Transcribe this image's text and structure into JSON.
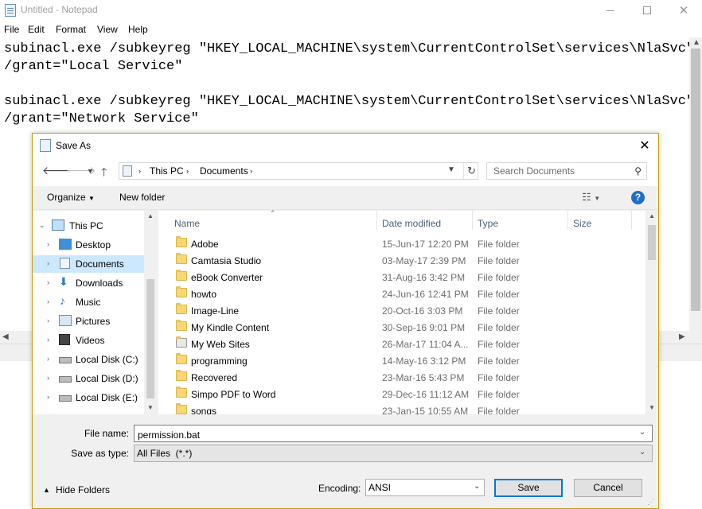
{
  "notepad": {
    "title": "Untitled - Notepad",
    "menu": [
      "File",
      "Edit",
      "Format",
      "View",
      "Help"
    ],
    "lines": [
      "subinacl.exe /subkeyreg \"HKEY_LOCAL_MACHINE\\system\\CurrentControlSet\\services\\NlaSvc\"",
      "/grant=\"Local Service\"",
      "",
      "subinacl.exe /subkeyreg \"HKEY_LOCAL_MACHINE\\system\\CurrentControlSet\\services\\NlaSvc\"",
      "/grant=\"Network Service\""
    ]
  },
  "dialog": {
    "title": "Save As",
    "breadcrumb": [
      "This PC",
      "Documents"
    ],
    "search_placeholder": "Search Documents",
    "toolbar": {
      "organize": "Organize",
      "new_folder": "New folder"
    },
    "tree": [
      {
        "label": "This PC",
        "icon": "computer-icon",
        "level": 0,
        "expanded": true
      },
      {
        "label": "Desktop",
        "icon": "desktop-icon",
        "level": 1
      },
      {
        "label": "Documents",
        "icon": "documents-icon",
        "level": 1,
        "selected": true
      },
      {
        "label": "Downloads",
        "icon": "downloads-icon",
        "level": 1
      },
      {
        "label": "Music",
        "icon": "music-icon",
        "level": 1
      },
      {
        "label": "Pictures",
        "icon": "pictures-icon",
        "level": 1
      },
      {
        "label": "Videos",
        "icon": "videos-icon",
        "level": 1
      },
      {
        "label": "Local Disk (C:)",
        "icon": "drive-icon",
        "level": 1
      },
      {
        "label": "Local Disk (D:)",
        "icon": "drive-icon",
        "level": 1
      },
      {
        "label": "Local Disk (E:)",
        "icon": "drive-icon",
        "level": 1
      }
    ],
    "columns": {
      "name": "Name",
      "date": "Date modified",
      "type": "Type",
      "size": "Size"
    },
    "files": [
      {
        "name": "Adobe",
        "date": "15-Jun-17 12:20 PM",
        "type": "File folder"
      },
      {
        "name": "Camtasia Studio",
        "date": "03-May-17 2:39 PM",
        "type": "File folder"
      },
      {
        "name": "eBook Converter",
        "date": "31-Aug-16 3:42 PM",
        "type": "File folder"
      },
      {
        "name": "howto",
        "date": "24-Jun-16 12:41 PM",
        "type": "File folder"
      },
      {
        "name": "Image-Line",
        "date": "20-Oct-16 3:03 PM",
        "type": "File folder"
      },
      {
        "name": "My Kindle Content",
        "date": "30-Sep-16 9:01 PM",
        "type": "File folder"
      },
      {
        "name": "My Web Sites",
        "date": "26-Mar-17 11:04 A...",
        "type": "File folder",
        "icon": "web-folder-icon"
      },
      {
        "name": "programming",
        "date": "14-May-16 3:12 PM",
        "type": "File folder"
      },
      {
        "name": "Recovered",
        "date": "23-Mar-16 5:43 PM",
        "type": "File folder"
      },
      {
        "name": "Simpo PDF to Word",
        "date": "29-Dec-16 11:12 AM",
        "type": "File folder"
      },
      {
        "name": "songs",
        "date": "23-Jan-15 10:55 AM",
        "type": "File folder"
      }
    ],
    "file_name_label": "File name:",
    "file_name_value": "permission.bat",
    "save_as_type_label": "Save as type:",
    "save_as_type_value": "All Files  (*.*)",
    "hide_folders": "Hide Folders",
    "encoding_label": "Encoding:",
    "encoding_value": "ANSI",
    "save": "Save",
    "cancel": "Cancel",
    "colors": {
      "accent": "#0078d7",
      "selection": "#cce8ff",
      "folder": "#f8d775",
      "dialog_border": "#c8a000"
    }
  }
}
